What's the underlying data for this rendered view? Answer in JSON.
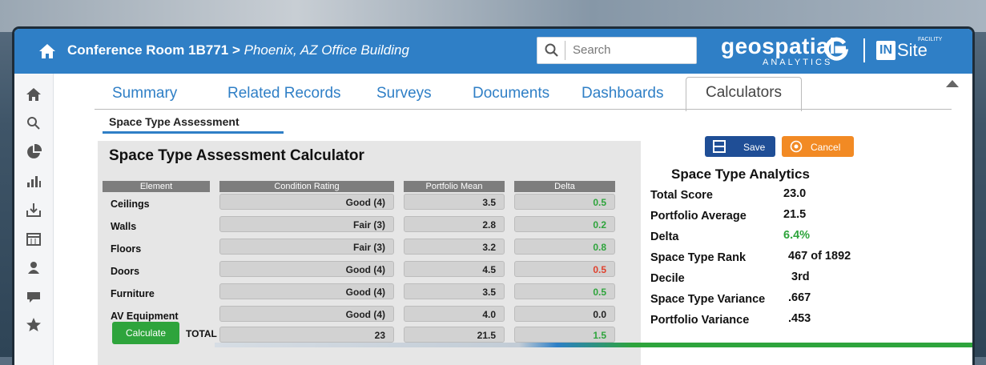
{
  "header": {
    "breadcrumb_main": "Conference Room 1B771",
    "breadcrumb_sep": " > ",
    "breadcrumb_sub": "Phoenix, AZ Office Building",
    "search_placeholder": "Search",
    "brand_name": "geospatial",
    "brand_sub": "ANALYTICS",
    "insite_in": "IN",
    "insite_site": "Site",
    "insite_facility": "FACILITY"
  },
  "sidebar": {
    "icons": [
      "home-icon",
      "search-icon",
      "pie-chart-icon",
      "bar-chart-icon",
      "download-icon",
      "calendar-icon",
      "user-icon",
      "message-icon",
      "star-icon"
    ]
  },
  "tabs": [
    "Summary",
    "Related Records",
    "Surveys",
    "Documents",
    "Dashboards",
    "Calculators"
  ],
  "active_tab": "Calculators",
  "subtab": "Space Type Assessment",
  "calculator": {
    "title": "Space Type Assessment Calculator",
    "save_label": "Save",
    "cancel_label": "Cancel",
    "calculate_label": "Calculate",
    "total_label": "TOTAL",
    "columns": [
      "Element",
      "Condition Rating",
      "Portfolio Mean",
      "Delta"
    ],
    "rows": [
      {
        "element": "Ceilings",
        "rating": "Good (4)",
        "mean": "3.5",
        "delta": "0.5",
        "tone": "pos"
      },
      {
        "element": "Walls",
        "rating": "Fair (3)",
        "mean": "2.8",
        "delta": "0.2",
        "tone": "pos"
      },
      {
        "element": "Floors",
        "rating": "Fair (3)",
        "mean": "3.2",
        "delta": "0.8",
        "tone": "pos"
      },
      {
        "element": "Doors",
        "rating": "Good (4)",
        "mean": "4.5",
        "delta": "0.5",
        "tone": "neg"
      },
      {
        "element": "Furniture",
        "rating": "Good (4)",
        "mean": "3.5",
        "delta": "0.5",
        "tone": "pos"
      },
      {
        "element": "AV Equipment",
        "rating": "Good (4)",
        "mean": "4.0",
        "delta": "0.0",
        "tone": "neutral"
      }
    ],
    "totals": {
      "rating": "23",
      "mean": "21.5",
      "delta": "1.5"
    }
  },
  "analytics": {
    "title": "Space Type Analytics",
    "items": [
      {
        "label": "Total Score",
        "value": "23.0",
        "tone": "neutral"
      },
      {
        "label": "Portfolio Average",
        "value": "21.5",
        "tone": "neutral"
      },
      {
        "label": "Delta",
        "value": "6.4%",
        "tone": "pos"
      },
      {
        "label": "Space Type Rank",
        "value": "467 of 1892",
        "tone": "neutral"
      },
      {
        "label": "Decile",
        "value": "3rd",
        "tone": "neutral"
      },
      {
        "label": "Space Type Variance",
        "value": ".667",
        "tone": "neutral"
      },
      {
        "label": "Portfolio Variance",
        "value": ".453",
        "tone": "neutral"
      }
    ]
  },
  "colors": {
    "brand_blue": "#2f7fc6",
    "save_blue": "#1f4e96",
    "cancel_orange": "#f28a24",
    "green": "#2ea43c",
    "red": "#e0402c"
  }
}
